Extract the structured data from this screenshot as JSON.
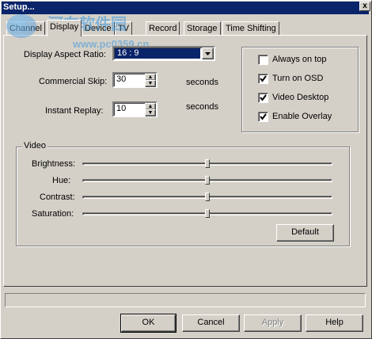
{
  "window": {
    "title": "Setup...",
    "close_glyph": "x"
  },
  "tabs": [
    {
      "label": "Channel",
      "active": false
    },
    {
      "label": "Display",
      "active": true
    },
    {
      "label": "Device",
      "active": false
    },
    {
      "label": "TV",
      "active": false
    },
    {
      "label": "Record",
      "active": false
    },
    {
      "label": "Storage",
      "active": false
    },
    {
      "label": "Time Shifting",
      "active": false
    }
  ],
  "display": {
    "aspect_label": "Display Aspect Ratio:",
    "aspect_value": "16 : 9",
    "commercial_skip_label": "Commercial Skip:",
    "commercial_skip_value": "30",
    "commercial_skip_unit": "seconds",
    "instant_replay_label": "Instant Replay:",
    "instant_replay_value": "10",
    "instant_replay_unit": "seconds"
  },
  "options": [
    {
      "label": "Always on top",
      "checked": false
    },
    {
      "label": "Turn on OSD",
      "checked": true
    },
    {
      "label": "Video Desktop",
      "checked": true
    },
    {
      "label": "Enable Overlay",
      "checked": true
    }
  ],
  "video": {
    "title": "Video",
    "sliders": [
      {
        "label": "Brightness:",
        "level": 0.5
      },
      {
        "label": "Hue:",
        "level": 0.5
      },
      {
        "label": "Contrast:",
        "level": 0.5
      },
      {
        "label": "Saturation:",
        "level": 0.5
      }
    ],
    "default_label": "Default"
  },
  "buttons": {
    "ok": "OK",
    "cancel": "Cancel",
    "apply": "Apply",
    "help": "Help"
  },
  "watermark": {
    "text": "河东软件园",
    "url": "www.pc0359.cn"
  },
  "icons": {
    "dropdown": "chevron-down-icon",
    "spin_up": "arrow-up-icon",
    "spin_down": "arrow-down-icon",
    "check": "checkmark-icon"
  }
}
